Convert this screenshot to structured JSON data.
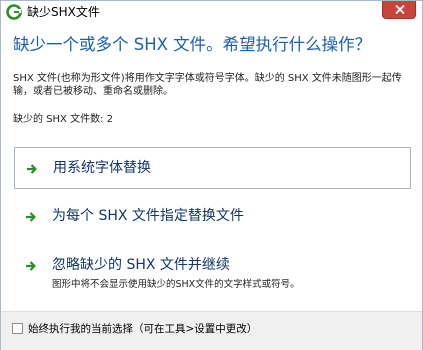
{
  "window": {
    "title": "缺少SHX文件"
  },
  "main": {
    "heading": "缺少一个或多个 SHX 文件。希望执行什么操作？",
    "description": "SHX 文件(也称为形文件)将用作文字字体或符号字体。缺少的 SHX 文件未随图形一起传输，或者已被移动、重命名或删除。",
    "missing_count": "缺少的 SHX 文件数: 2"
  },
  "options": [
    {
      "label": "用系统字体替换"
    },
    {
      "label": "为每个 SHX 文件指定替换文件"
    },
    {
      "label": "忽略缺少的 SHX 文件并继续",
      "sublabel": "图形中将不会显示使用缺少的SHX文件的文字样式或符号。"
    }
  ],
  "footer": {
    "remember_label": "始终执行我的当前选择（可在工具>设置中更改）",
    "remember_checked": false
  },
  "colors": {
    "heading": "#1b5fb0",
    "arrow": "#2e8b2e",
    "option_text": "#14366b",
    "close_button": "#c7463b"
  },
  "icons": {
    "app": "autocad-logo-icon",
    "close": "close-icon",
    "option_arrow": "green-arrow-right-icon"
  }
}
